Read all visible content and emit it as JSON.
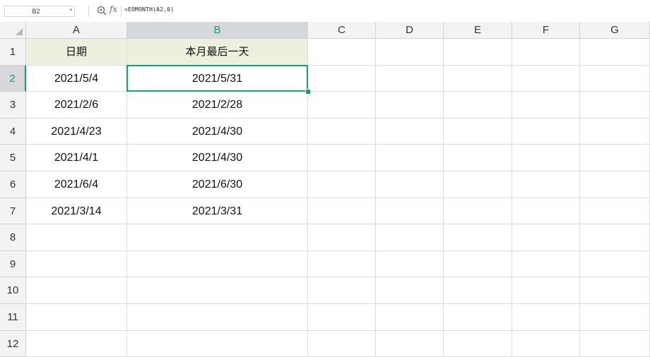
{
  "formula_bar": {
    "cell_ref": "B2",
    "formula": "=EOMONTH(A2,0)"
  },
  "icons": [
    "zoom-icon",
    "fx-icon",
    "dropdown-arrow-icon",
    "select-all-icon"
  ],
  "columns": [
    "A",
    "B",
    "C",
    "D",
    "E",
    "F",
    "G"
  ],
  "rows": [
    "1",
    "2",
    "3",
    "4",
    "5",
    "6",
    "7",
    "8",
    "9",
    "10",
    "11",
    "12"
  ],
  "cells": [
    [
      "日期",
      "本月最后一天"
    ],
    [
      "2021/5/4",
      "2021/5/31"
    ],
    [
      "2021/2/6",
      "2021/2/28"
    ],
    [
      "2021/4/23",
      "2021/4/30"
    ],
    [
      "2021/4/1",
      "2021/4/30"
    ],
    [
      "2021/6/4",
      "2021/6/30"
    ],
    [
      "2021/3/14",
      "2021/3/31"
    ]
  ],
  "selection": {
    "column": "B",
    "row": "2"
  },
  "colors": {
    "accent": "#1a9e6a",
    "header_fill": "#ebf1de",
    "selected_header": "#d5d9de"
  }
}
